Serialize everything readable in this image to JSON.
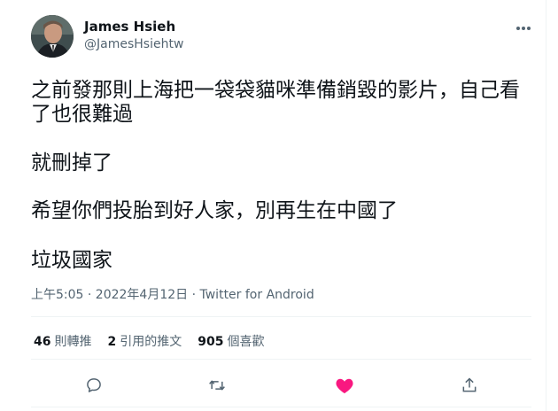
{
  "author": {
    "name": "James Hsieh",
    "handle": "@JamesHsiehtw",
    "avatar_icon": "user-avatar-photo"
  },
  "tweet": {
    "lines": [
      "之前發那則上海把一袋袋貓咪準備銷毀的影片，自己看",
      "了也很難過",
      "就刪掉了",
      "希望你們投胎到好人家，別再生在中國了",
      "垃圾國家"
    ],
    "time": "上午5:05 · 2022年4月12日",
    "separator": " · ",
    "source": "Twitter for Android"
  },
  "stats": {
    "retweets_count": "46",
    "retweets_label": "則轉推",
    "quotes_count": "2",
    "quotes_label": "引用的推文",
    "likes_count": "905",
    "likes_label": "個喜歡"
  },
  "actions": {
    "reply_icon": "reply-bubble-icon",
    "retweet_icon": "retweet-icon",
    "like_icon": "heart-icon",
    "share_icon": "share-icon",
    "more_icon": "more-dots-icon"
  },
  "colors": {
    "text": "#0f1419",
    "secondary": "#536471",
    "like": "#f91880",
    "divider": "#eff3f4"
  }
}
